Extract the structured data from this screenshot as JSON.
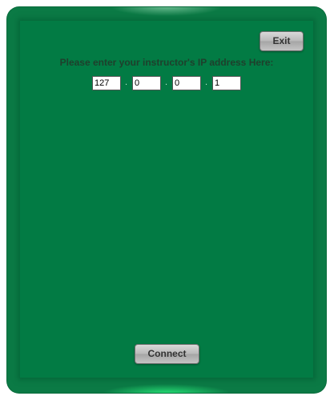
{
  "dialog": {
    "exit_label": "Exit",
    "prompt": "Please enter your instructor's IP address Here:",
    "ip_octets": [
      "127",
      "0",
      "0",
      "1"
    ],
    "separator": ".",
    "connect_label": "Connect"
  },
  "colors": {
    "background": "#027b44",
    "frame": "#0b7a45",
    "button": "#b8b8b8",
    "prompt_text": "#1f3f2c"
  }
}
